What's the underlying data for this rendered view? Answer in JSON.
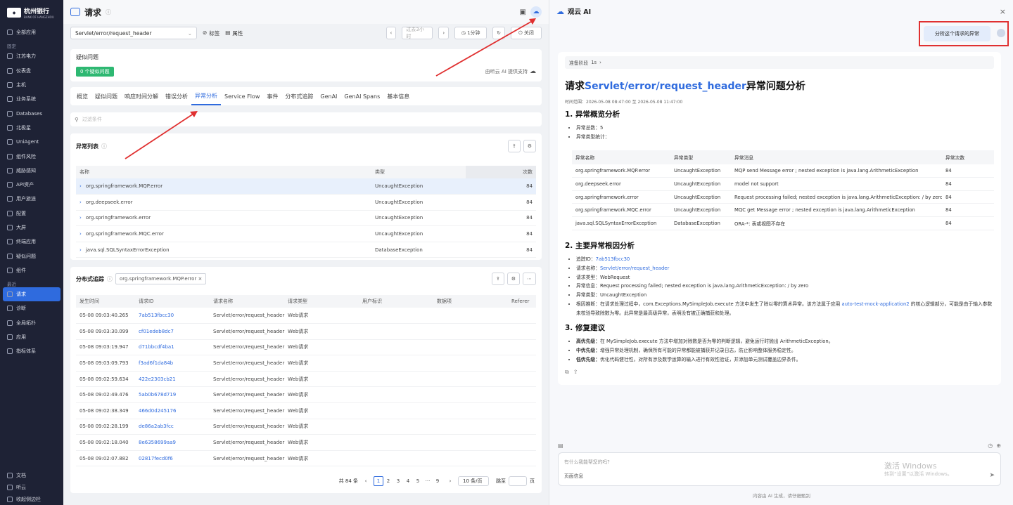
{
  "sidebar": {
    "brand": "杭州银行",
    "brand_sub": "BANK OF HANGZHOU",
    "all_apps": "全部应用",
    "pinned_label": "固定",
    "pinned": [
      "江苏电力",
      "仪表盘",
      "主机",
      "业务系统",
      "Databases",
      "北极星",
      "UniAgent",
      "组件风险",
      "威胁感知",
      "API资产",
      "用户旅途",
      "配置",
      "大屏",
      "终端应用",
      "疑似问题",
      "组件"
    ],
    "recent_label": "最近",
    "recent": [
      "请求",
      "诊断",
      "全局拓扑",
      "应用",
      "指标体系"
    ],
    "bottom": [
      "文档",
      "听云",
      "收起侧边栏"
    ]
  },
  "header": {
    "title": "请求",
    "request_select": "Servlet/error/request_header",
    "tags_btn": "标签",
    "attr_btn": "属性",
    "time_range": "过去3小时",
    "interval": "1分钟",
    "close_btn": "关闭"
  },
  "suspect": {
    "title": "疑似问题",
    "badge": "0 个疑似问题",
    "powered": "由听云 AI 提供支持"
  },
  "tabs": [
    "概览",
    "疑似问题",
    "响应时间分解",
    "错误分析",
    "异常分析",
    "Service Flow",
    "事件",
    "分布式追踪",
    "GenAI",
    "GenAI Spans",
    "基本信息"
  ],
  "active_tab": "异常分析",
  "filter_placeholder": "过滤条件",
  "exceptions": {
    "title": "异常列表",
    "columns": [
      "名称",
      "类型",
      "次数"
    ],
    "rows": [
      {
        "name": "org.springframework.MQP.error",
        "type": "UncaughtException",
        "count": "84"
      },
      {
        "name": "org.deepseek.error",
        "type": "UncaughtException",
        "count": "84"
      },
      {
        "name": "org.springframework.error",
        "type": "UncaughtException",
        "count": "84"
      },
      {
        "name": "org.springframework.MQC.error",
        "type": "UncaughtException",
        "count": "84"
      },
      {
        "name": "java.sql.SQLSyntaxErrorException",
        "type": "DatabaseException",
        "count": "84"
      }
    ]
  },
  "traces": {
    "title": "分布式追踪",
    "filter_tag": "org.springframework.MQP.error",
    "columns": [
      "发生时间",
      "请求ID",
      "请求名称",
      "请求类型",
      "用户标识",
      "数据项",
      "Referer"
    ],
    "rows": [
      {
        "time": "05-08 09:03:40.265",
        "id": "7ab513fbcc30",
        "name": "Servlet/error/request_header",
        "type": "Web请求"
      },
      {
        "time": "05-08 09:03:30.099",
        "id": "cf01edeb8dc7",
        "name": "Servlet/error/request_header",
        "type": "Web请求"
      },
      {
        "time": "05-08 09:03:19.947",
        "id": "d71bbcdf4ba1",
        "name": "Servlet/error/request_header",
        "type": "Web请求"
      },
      {
        "time": "05-08 09:03:09.793",
        "id": "f3ad6f1da84b",
        "name": "Servlet/error/request_header",
        "type": "Web请求"
      },
      {
        "time": "05-08 09:02:59.634",
        "id": "422e2303cb21",
        "name": "Servlet/error/request_header",
        "type": "Web请求"
      },
      {
        "time": "05-08 09:02:49.476",
        "id": "5ab0b678d719",
        "name": "Servlet/error/request_header",
        "type": "Web请求"
      },
      {
        "time": "05-08 09:02:38.349",
        "id": "466d0d245176",
        "name": "Servlet/error/request_header",
        "type": "Web请求"
      },
      {
        "time": "05-08 09:02:28.199",
        "id": "de86a2ab3fcc",
        "name": "Servlet/error/request_header",
        "type": "Web请求"
      },
      {
        "time": "05-08 09:02:18.040",
        "id": "8e6358699aa9",
        "name": "Servlet/error/request_header",
        "type": "Web请求"
      },
      {
        "time": "05-08 09:02:07.882",
        "id": "02817fecd0f6",
        "name": "Servlet/error/request_header",
        "type": "Web请求"
      }
    ],
    "total": "共 84 条",
    "pages": [
      "1",
      "2",
      "3",
      "4",
      "5",
      "···",
      "9"
    ],
    "page_size": "10 条/页",
    "goto": "跳至",
    "page_unit": "页"
  },
  "ai": {
    "title": "观云 AI",
    "user_msg": "分析这个请求的异常",
    "stage": "准备阶段",
    "stage_time": "1s",
    "report_title_pre": "请求",
    "report_title_link": "Servlet/error/request_header",
    "report_title_post": "异常问题分析",
    "time_range": "时间范围：2026-05-08 08:47:00 至 2026-05-08 11:47:00",
    "s1": "1. 异常概览分析",
    "s1_items": [
      "异常总数：5",
      "异常类型统计："
    ],
    "table_cols": [
      "异常名称",
      "异常类型",
      "异常消息",
      "异常次数"
    ],
    "table_rows": [
      {
        "name": "org.springframework.MQP.error",
        "type": "UncaughtException",
        "msg": "MQP send Message error ; nested exception is java.lang.ArithmeticException",
        "count": "84"
      },
      {
        "name": "org.deepseek.error",
        "type": "UncaughtException",
        "msg": "model not support",
        "count": "84"
      },
      {
        "name": "org.springframework.error",
        "type": "UncaughtException",
        "msg": "Request processing failed; nested exception is java.lang.ArithmeticException: / by zero",
        "count": "84"
      },
      {
        "name": "org.springframework.MQC.error",
        "type": "UncaughtException",
        "msg": "MQC get Message error ; nested exception is java.lang.ArithmeticException",
        "count": "84"
      },
      {
        "name": "java.sql.SQLSyntaxErrorException",
        "type": "DatabaseException",
        "msg": "ORA-*: 表或视图不存在",
        "count": "84"
      }
    ],
    "s2": "2. 主要异常根因分析",
    "s2_trace_label": "追踪ID：",
    "s2_trace_id": "7ab513fbcc30",
    "s2_req_label": "请求名称：",
    "s2_req_name": "Servlet/error/request_header",
    "s2_items": [
      "请求类型：WebRequest",
      "异常信息：Request processing failed; nested exception is java.lang.ArithmeticException: / by zero",
      "异常类型：UncaughtException"
    ],
    "s2_root_pre": "根因推断：在请求处理过程中，com.Exceptions.MySimpleJob.execute 方法中发生了除以零的算术异常。该方法属于应用 ",
    "s2_root_app": "auto-test-mock-application2",
    "s2_root_post": " 的核心逻辑部分，可能是由于输入参数未校验导致除数为零。此异常是最高级异常，表明没有被正确捕获和处理。",
    "s3": "3. 修复建议",
    "s3_items": [
      {
        "label": "高优先级：",
        "text": "在 MySimpleJob.execute 方法中增加对除数是否为零的判断逻辑，避免运行时抛出 ArithmeticException。"
      },
      {
        "label": "中优先级：",
        "text": "增强异常处理机制，确保所有可能的异常都能被捕获并记录日志，防止影响整体服务稳定性。"
      },
      {
        "label": "低优先级：",
        "text": "优化代码健壮性，对所有涉及数学运算的输入进行有效性验证，并添加单元测试覆盖边界条件。"
      }
    ],
    "input_placeholder": "有什么我能帮您的吗?",
    "page_info": "页面信息",
    "footer": "内容由 AI 生成，请仔细甄别",
    "watermark1": "激活 Windows",
    "watermark2": "转到“设置”以激活 Windows。"
  }
}
